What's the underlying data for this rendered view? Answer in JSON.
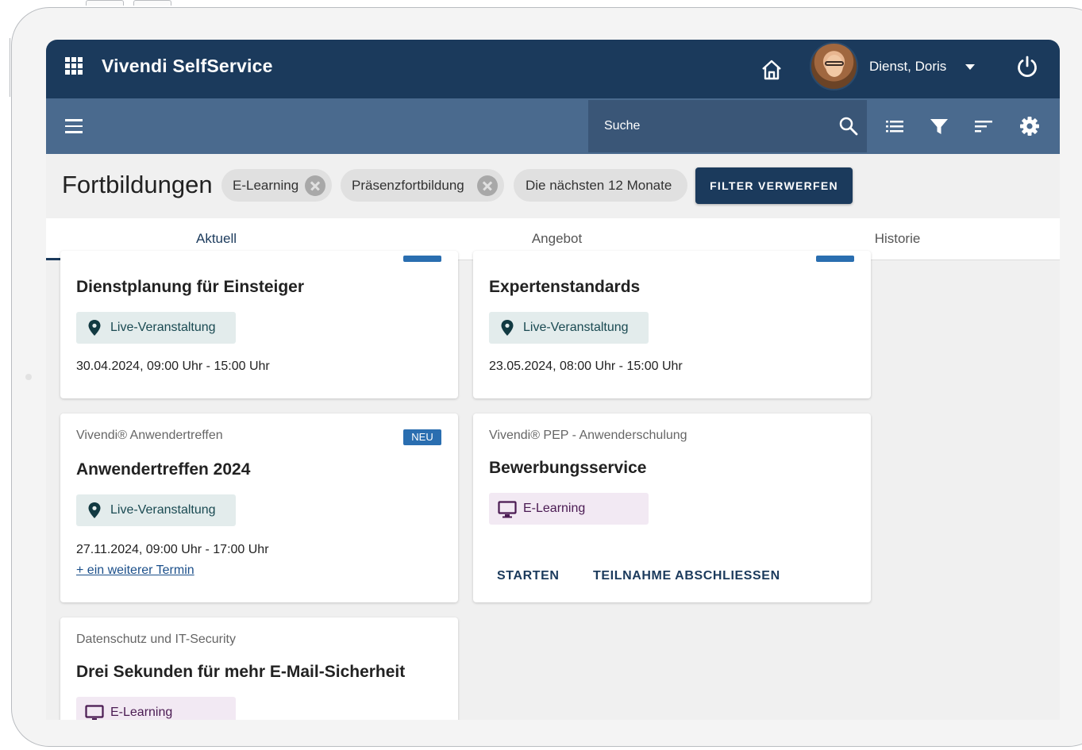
{
  "app": {
    "title": "Vivendi SelfService"
  },
  "user": {
    "name": "Dienst, Doris"
  },
  "search": {
    "placeholder": "Suche"
  },
  "page": {
    "title": "Fortbildungen"
  },
  "filters": {
    "chips": [
      "E-Learning",
      "Präsenzfortbildung",
      "Die nächsten 12 Monate"
    ],
    "clear_label": "FILTER VERWERFEN"
  },
  "tabs": [
    {
      "label": "Aktuell",
      "active": true
    },
    {
      "label": "Angebot",
      "active": false
    },
    {
      "label": "Historie",
      "active": false
    }
  ],
  "cards": [
    {
      "category": "",
      "title": "Dienstplanung für Einsteiger",
      "badge": "",
      "type": "Live-Veranstaltung",
      "type_icon": "map-pin-icon",
      "date": "30.04.2024, 09:00 Uhr - 15:00 Uhr"
    },
    {
      "category": "",
      "title": "Expertenstandards",
      "badge": "",
      "type": "Live-Veranstaltung",
      "type_icon": "map-pin-icon",
      "date": "23.05.2024, 08:00 Uhr - 15:00 Uhr"
    },
    {
      "category": "Vivendi® Anwendertreffen",
      "title": "Anwendertreffen 2024",
      "badge": "NEU",
      "type": "Live-Veranstaltung",
      "type_icon": "map-pin-icon",
      "date": "27.11.2024, 09:00 Uhr - 17:00 Uhr",
      "more_link": "+ ein weiterer Termin"
    },
    {
      "category": "Vivendi® PEP - Anwenderschulung",
      "title": "Bewerbungsservice",
      "badge": "",
      "type": "E-Learning",
      "type_icon": "monitor-icon",
      "actions": [
        "STARTEN",
        "TEILNAHME ABSCHLIESSEN"
      ]
    },
    {
      "category": "Datenschutz und IT-Security",
      "title": "Drei Sekunden für mehr E-Mail-Sicherheit",
      "badge": "",
      "type": "E-Learning",
      "type_icon": "monitor-icon"
    }
  ],
  "colors": {
    "primary": "#1b3a5c",
    "toolbar": "#4a6a8e",
    "badge": "#2a6eb0",
    "live_pill": "#e3ecec",
    "elearning_pill": "#f2e9f3"
  }
}
